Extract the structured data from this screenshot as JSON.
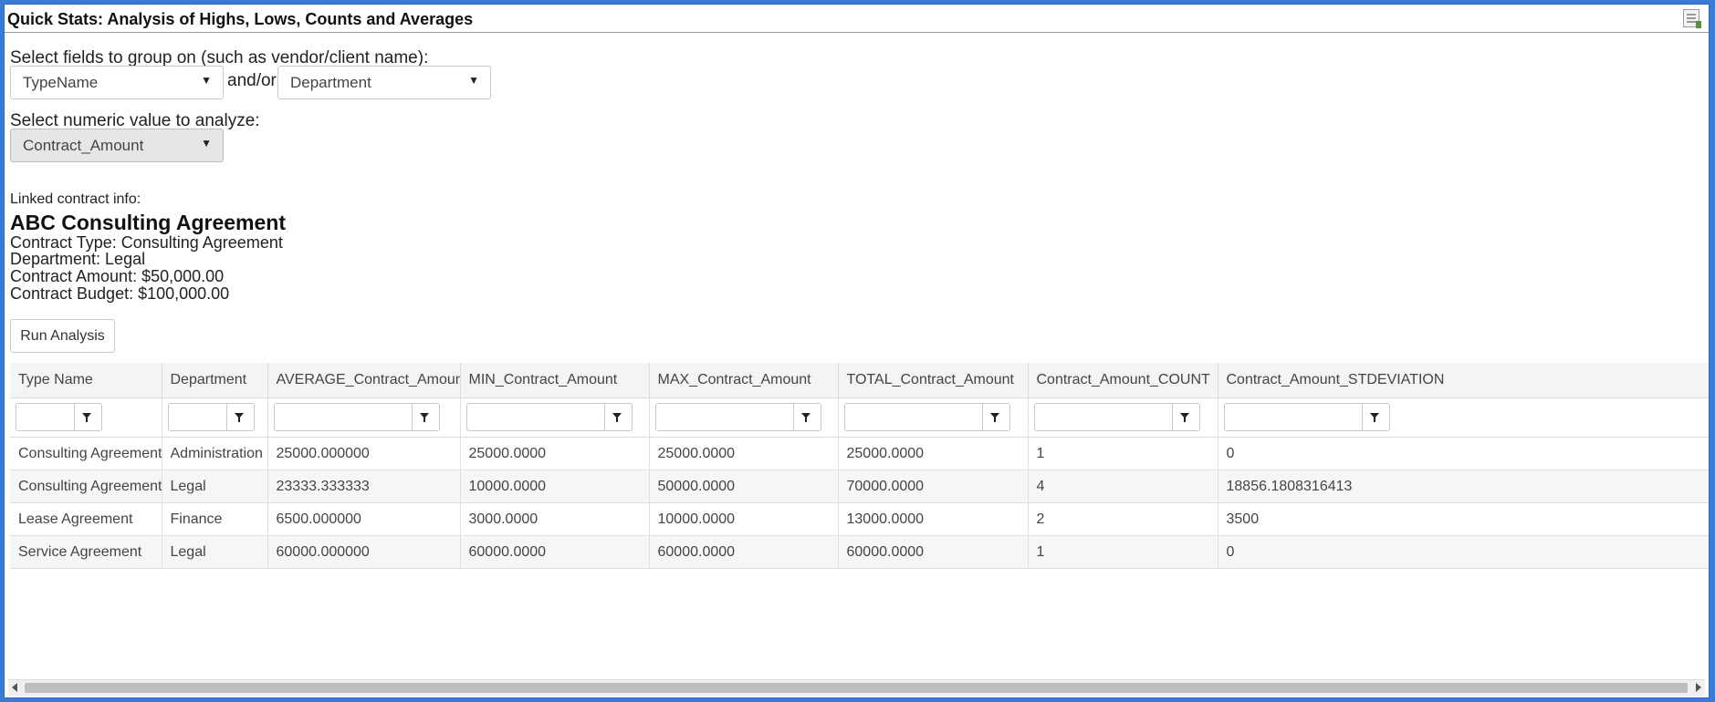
{
  "title": "Quick Stats: Analysis of Highs, Lows, Counts and Averages",
  "group_label": "Select fields to group on (such as vendor/client name):",
  "group_field_1": "TypeName",
  "andor": "and/or",
  "group_field_2": "Department",
  "numeric_label": "Select numeric value to analyze:",
  "numeric_field": "Contract_Amount",
  "linked": {
    "label": "Linked contract info:",
    "name": "ABC Consulting Agreement",
    "type": "Contract Type: Consulting Agreement",
    "department": "Department: Legal",
    "amount": "Contract Amount: $50,000.00",
    "budget": "Contract Budget: $100,000.00"
  },
  "run_label": "Run Analysis",
  "columns": [
    "Type Name",
    "Department",
    "AVERAGE_Contract_Amount",
    "MIN_Contract_Amount",
    "MAX_Contract_Amount",
    "TOTAL_Contract_Amount",
    "Contract_Amount_COUNT",
    "Contract_Amount_STDEVIATION"
  ],
  "rows": [
    [
      "Consulting Agreement",
      "Administration",
      "25000.000000",
      "25000.0000",
      "25000.0000",
      "25000.0000",
      "1",
      "0"
    ],
    [
      "Consulting Agreement",
      "Legal",
      "23333.333333",
      "10000.0000",
      "50000.0000",
      "70000.0000",
      "4",
      "18856.1808316413"
    ],
    [
      "Lease Agreement",
      "Finance",
      "6500.000000",
      "3000.0000",
      "10000.0000",
      "13000.0000",
      "2",
      "3500"
    ],
    [
      "Service Agreement",
      "Legal",
      "60000.000000",
      "60000.0000",
      "60000.0000",
      "60000.0000",
      "1",
      "0"
    ]
  ]
}
